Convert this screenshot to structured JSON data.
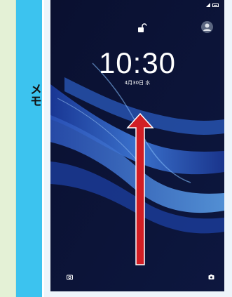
{
  "sidebar": {
    "label": "メモ"
  },
  "lockscreen": {
    "time": "10:30",
    "date": "4月30日 水",
    "icons": {
      "lock": "unlocked-padlock-icon",
      "avatar": "user-avatar-icon",
      "left_corner": "camera-icon",
      "right_corner": "camera-icon",
      "battery": "battery-icon",
      "signal": "signal-icon"
    },
    "colors": {
      "background": "#0c1436",
      "accent_arrow": "#d21e24",
      "sidebar_blue": "#3cc3ef",
      "memo_green": "#e4f1d6"
    },
    "gesture": "swipe-up"
  }
}
